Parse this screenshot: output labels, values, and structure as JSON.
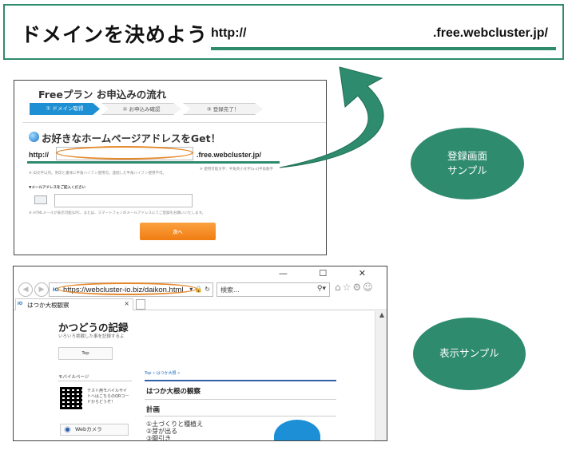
{
  "header": {
    "title": "ドメインを決めよう",
    "url_prefix": "http://",
    "url_suffix": ".free.webcluster.jp/"
  },
  "registration_sample": {
    "title": "Freeプラン お申込みの流れ",
    "steps": [
      {
        "label": "① ドメイン取得",
        "active": true
      },
      {
        "label": "② お申込み確認",
        "active": false
      },
      {
        "label": "③ 登録完了！",
        "active": false
      }
    ],
    "heading": "お好きなホームページアドレスをGet！",
    "address_prefix": "http://",
    "address_suffix": ".free.webcluster.jp/",
    "note_left": "※ ID文字以内。英印と書体に半角ハイフン使用可。連続した半角ハイフン使用不可。",
    "note_right": "※ 使用可能文字：半角英小文字[a-z]半角数字",
    "mail_label": "▼メールアドレスをご記入ください",
    "mail_note": "※ HTMLメールが表示可能なPC、または、スマートフォンのメールアドレスにてご登録をお願いいたします。",
    "next_button": "次へ",
    "accent_color": "#e58a2e",
    "step_active_color": "#1e8fd2"
  },
  "callouts": {
    "registration": "登録画面\nサンプル",
    "display": "表示サンプル",
    "color": "#2e8b6e"
  },
  "browser_sample": {
    "window_controls": "— ☐ ✕",
    "url": "https://webcluster-io.biz/daikon.html",
    "search_placeholder": "検索...",
    "site_icon": "IO",
    "tab_title": "はつか大根観察",
    "tab_close": "×",
    "site_title": "かつどうの記録",
    "site_subtitle": "いろいろ挑戦した事を記録するよ",
    "top_button": "Top",
    "mobile_label": "モバイルページ",
    "qr_text": "テスト用モバイルサイトへはこちらのQRコードからどうぞ！",
    "webcam_button": "Webカメラ",
    "breadcrumb": "Top » はつか大根 »",
    "post_title": "はつか大根の観察",
    "section_title": "計画",
    "list_items": [
      "①土づくりと種植え",
      "②芽が出る",
      "③間引き"
    ]
  }
}
